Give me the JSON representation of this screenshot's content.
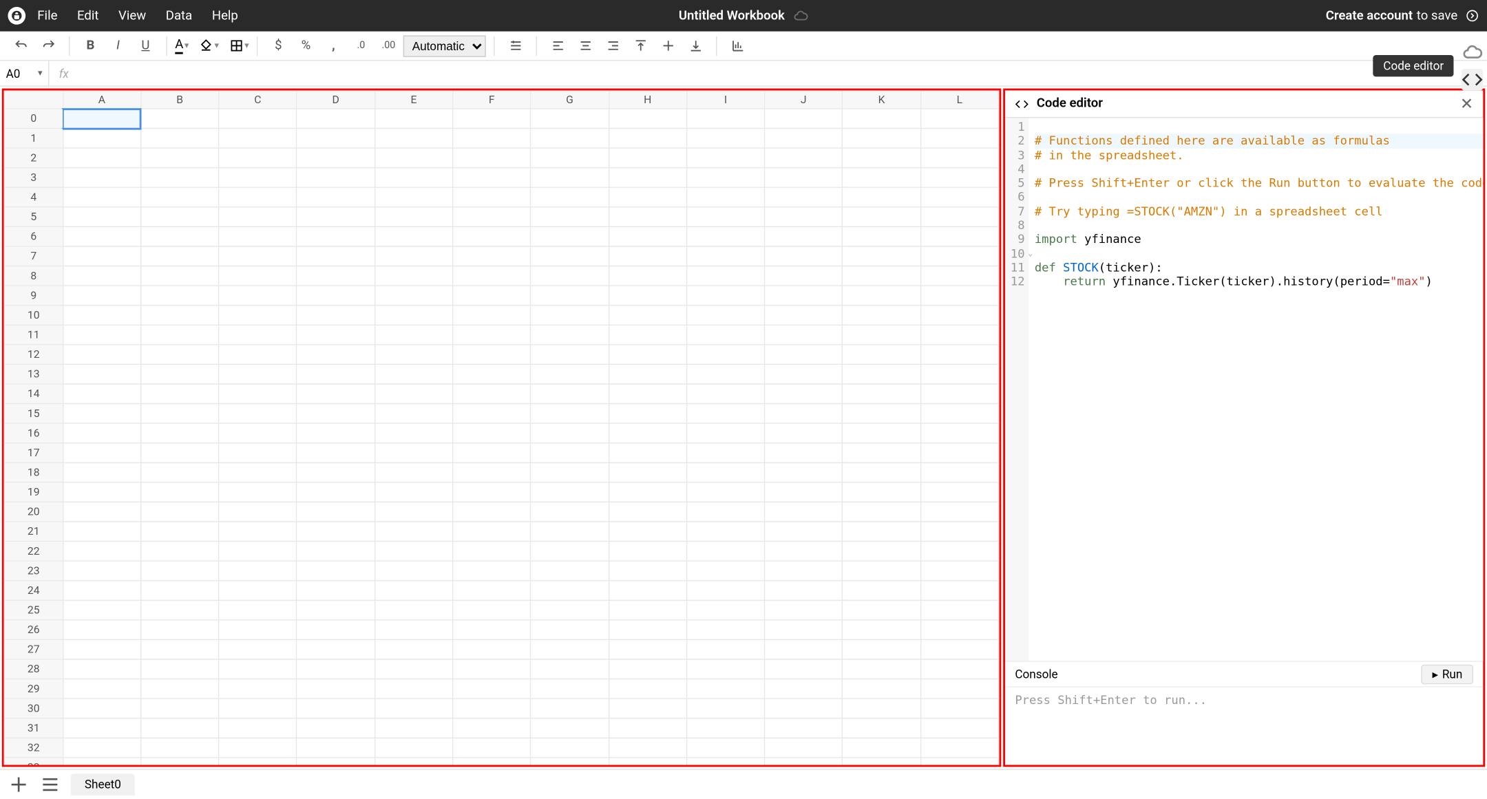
{
  "menubar": {
    "items": [
      "File",
      "Edit",
      "View",
      "Data",
      "Help"
    ],
    "title": "Untitled Workbook",
    "cta_bold": "Create account",
    "cta_rest": " to save"
  },
  "toolbar": {
    "format_select": "Automatic"
  },
  "formula": {
    "cellref": "A0",
    "fx_label": "fx",
    "value": ""
  },
  "sheet": {
    "columns": [
      "A",
      "B",
      "C",
      "D",
      "E",
      "F",
      "G",
      "H",
      "I",
      "J",
      "K",
      "L"
    ],
    "rowcount": 34,
    "selected": "A0"
  },
  "code": {
    "title": "Code editor",
    "tooltip": "Code editor",
    "lines": [
      {
        "n": 1,
        "t": ""
      },
      {
        "n": 2,
        "t": "# Functions defined here are available as formulas",
        "hl": true,
        "cls": "c-comment"
      },
      {
        "n": 3,
        "t": "# in the spreadsheet.",
        "cls": "c-comment"
      },
      {
        "n": 4,
        "t": ""
      },
      {
        "n": 5,
        "t": "# Press Shift+Enter or click the Run button to evaluate the code window",
        "cls": "c-comment"
      },
      {
        "n": 6,
        "t": ""
      },
      {
        "n": 7,
        "t": "# Try typing =STOCK(\"AMZN\") in a spreadsheet cell",
        "cls": "c-comment"
      },
      {
        "n": 8,
        "t": ""
      },
      {
        "n": 9,
        "html": "<span class='c-kw'>import</span> yfinance"
      },
      {
        "n": 10,
        "t": "",
        "fold": true
      },
      {
        "n": 11,
        "html": "<span class='c-kw'>def</span> <span class='c-fn'>STOCK</span>(ticker):"
      },
      {
        "n": 12,
        "html": "    <span class='c-kw'>return</span> yfinance.Ticker(ticker).history(period=<span class='c-str'>\"max\"</span>)"
      }
    ],
    "console_label": "Console",
    "run_label": "Run",
    "console_placeholder": "Press Shift+Enter to run..."
  },
  "tabs": {
    "sheet": "Sheet0"
  }
}
